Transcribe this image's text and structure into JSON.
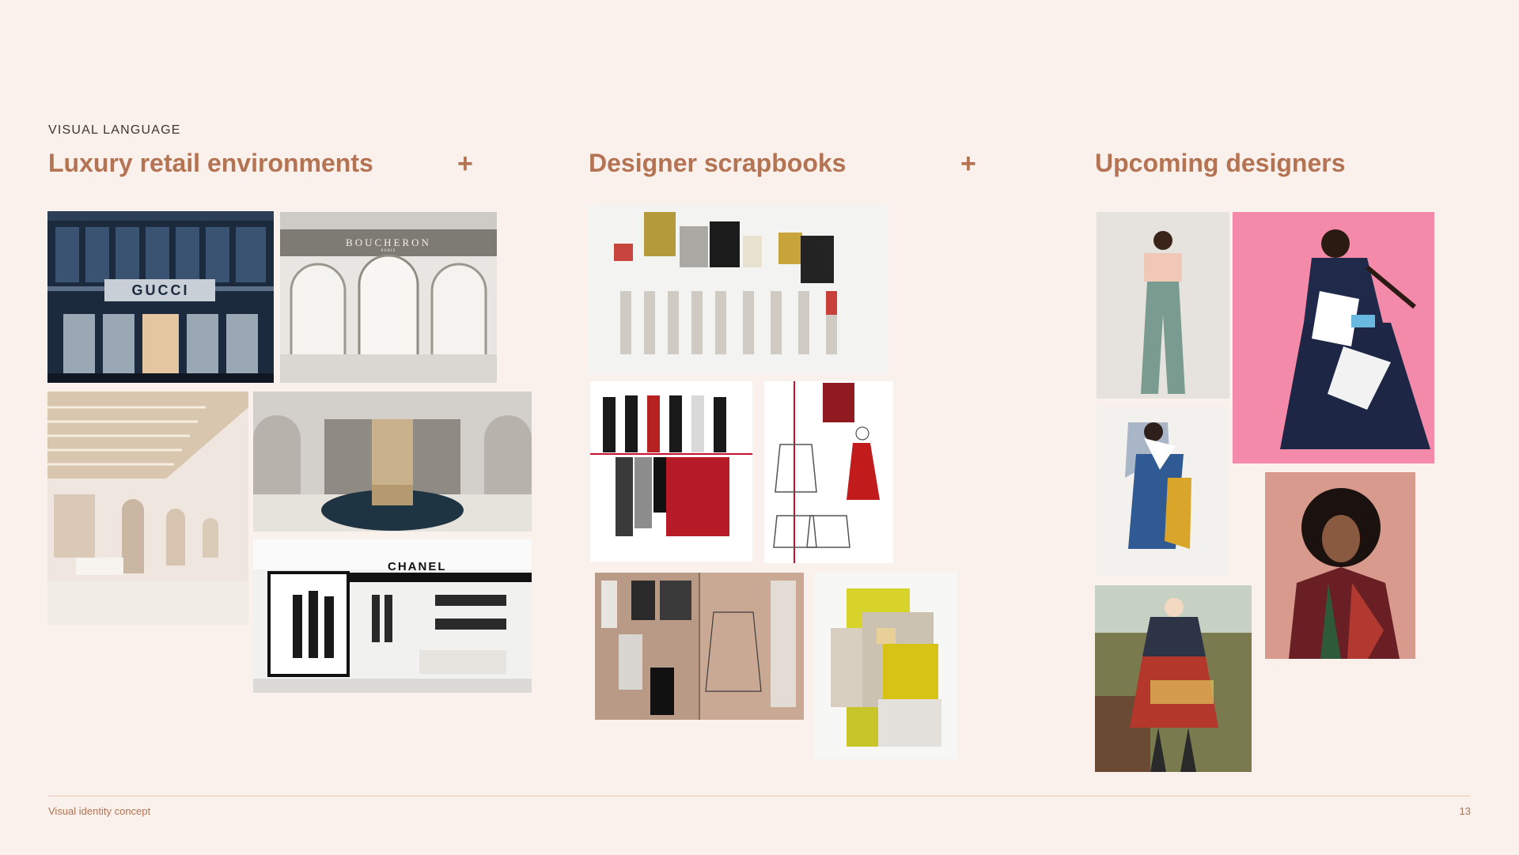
{
  "section_label": "VISUAL LANGUAGE",
  "columns": [
    {
      "title": "Luxury retail environments"
    },
    {
      "title": "Designer scrapbooks"
    },
    {
      "title": "Upcoming designers"
    }
  ],
  "separator": "+",
  "store_signs": {
    "gucci": "GUCCI",
    "boucheron": "BOUCHERON",
    "boucheron_sub": "PARIS",
    "chanel": "CHANEL"
  },
  "footer": {
    "label": "Visual identity concept",
    "page_number": "13"
  },
  "colors": {
    "background": "#fbf1ec",
    "accent": "#b47352",
    "text": "#3d3330"
  }
}
